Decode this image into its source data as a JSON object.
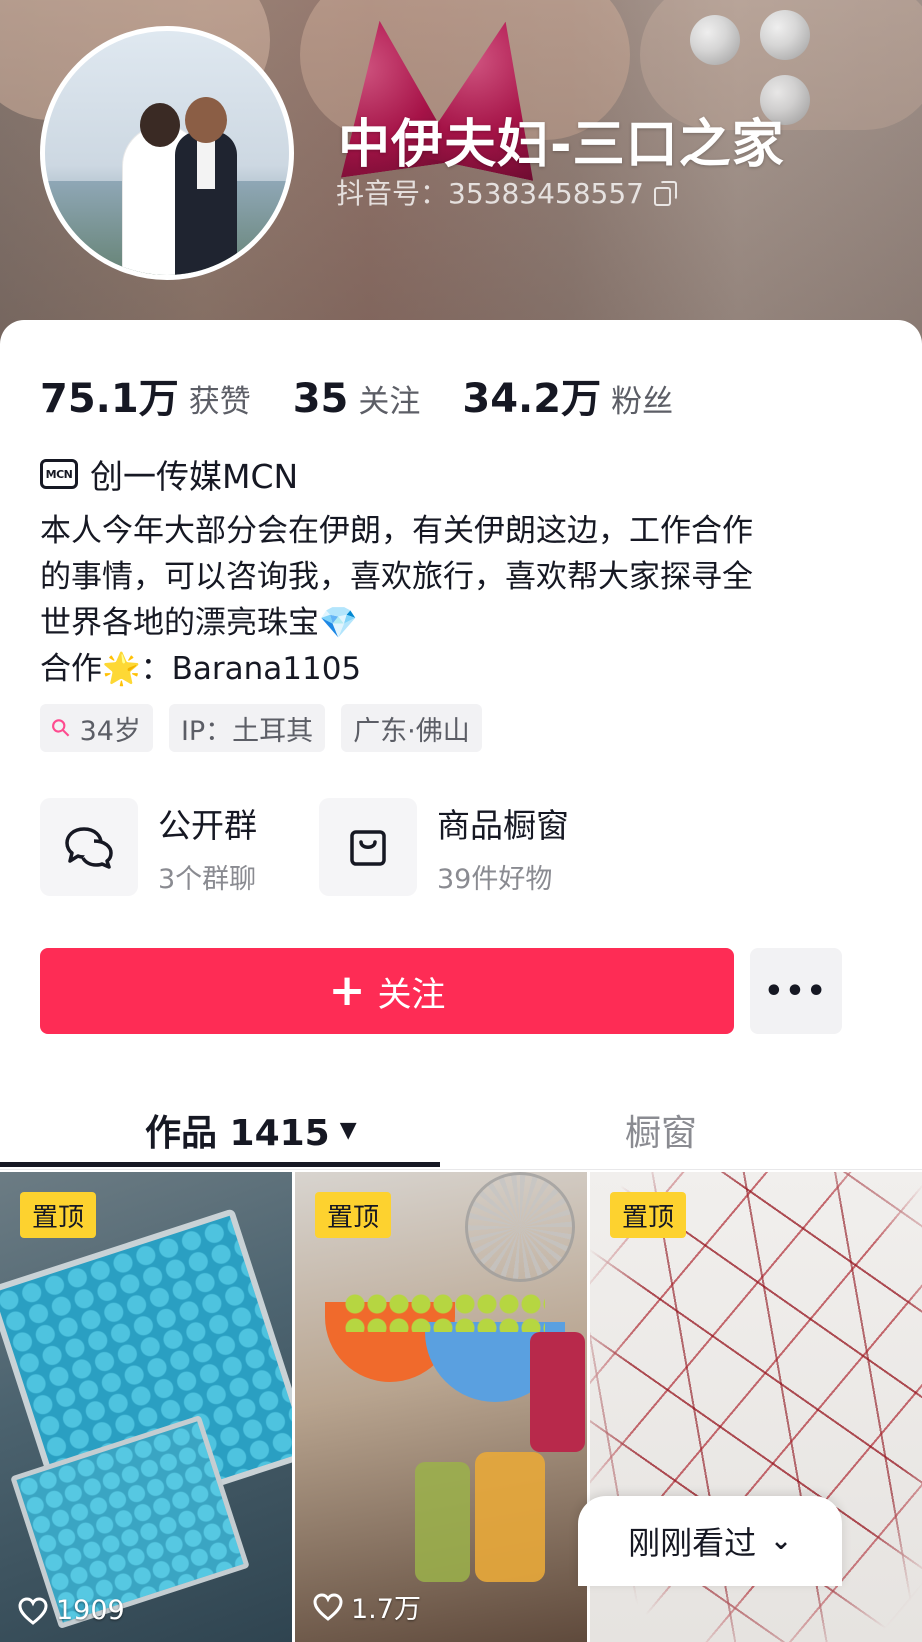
{
  "profile": {
    "nickname": "中伊夫妇-三口之家",
    "douyin_id": "抖音号：35383458557"
  },
  "stats": [
    {
      "value": "75.1万",
      "label": "获赞"
    },
    {
      "value": "35",
      "label": "关注"
    },
    {
      "value": "34.2万",
      "label": "粉丝"
    }
  ],
  "mcn": {
    "icon_text": "MCN",
    "label": "创一传媒MCN"
  },
  "bio": {
    "lines": [
      "本人今年大部分会在伊朗，有关伊朗这边，工作合作",
      "的事情，可以咨询我，喜欢旅行，喜欢帮大家探寻全",
      "世界各地的漂亮珠宝",
      "合作"
    ],
    "line3_emoji": "💎",
    "line4_emoji": "🌟",
    "line4_rest": "：Barana1105"
  },
  "tags": {
    "age": "34岁",
    "ip": "IP：土耳其",
    "location": "广东·佛山"
  },
  "features": [
    {
      "title": "公开群",
      "subtitle": "3个群聊",
      "icon": "chat-bubbles-icon"
    },
    {
      "title": "商品橱窗",
      "subtitle": "39件好物",
      "icon": "shopping-bag-icon"
    }
  ],
  "actions": {
    "follow_label": "关注",
    "more_label": "•••"
  },
  "tabs": {
    "works_label": "作品 1415",
    "showcase_label": "橱窗"
  },
  "videos": [
    {
      "pinned_label": "置顶",
      "likes": "1909"
    },
    {
      "pinned_label": "置顶",
      "likes": "1.7万"
    },
    {
      "pinned_label": "置顶",
      "likes": ""
    }
  ],
  "recent": {
    "label": "刚刚看过"
  },
  "colors": {
    "accent": "#fe2c55",
    "pin_badge": "#fdd22f",
    "text_primary": "#161823",
    "text_secondary": "#8a8b91"
  }
}
